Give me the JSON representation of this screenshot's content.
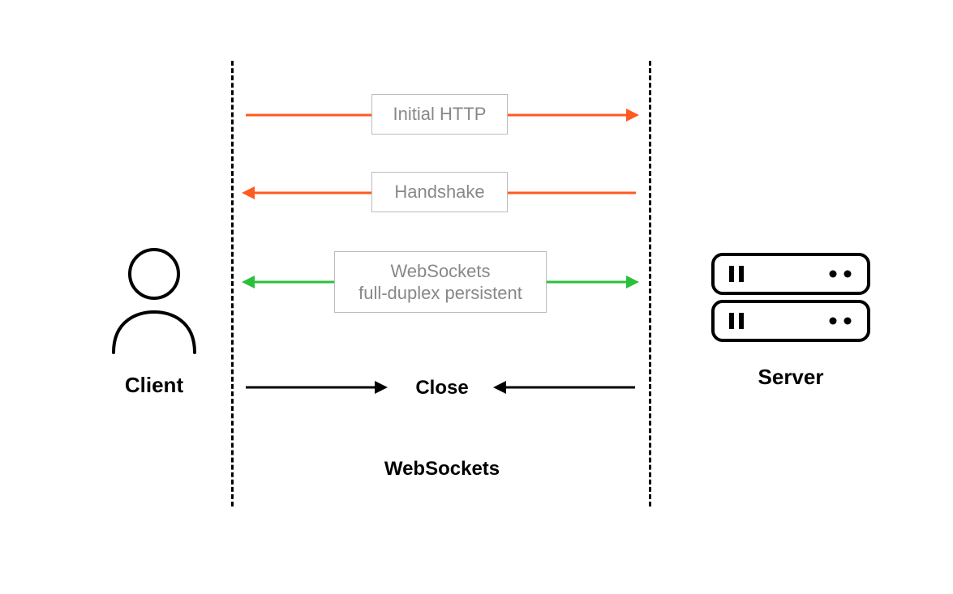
{
  "left_entity_label": "Client",
  "right_entity_label": "Server",
  "steps": {
    "initial_http": "Initial HTTP",
    "handshake": "Handshake",
    "websockets_line1": "WebSockets",
    "websockets_line2": "full-duplex persistent",
    "close": "Close"
  },
  "diagram_title": "WebSockets",
  "colors": {
    "orange": "#ff5a1f",
    "green": "#2bbf3a",
    "black": "#000000",
    "grey_text": "#888888",
    "grey_border": "#bbbbbb"
  }
}
